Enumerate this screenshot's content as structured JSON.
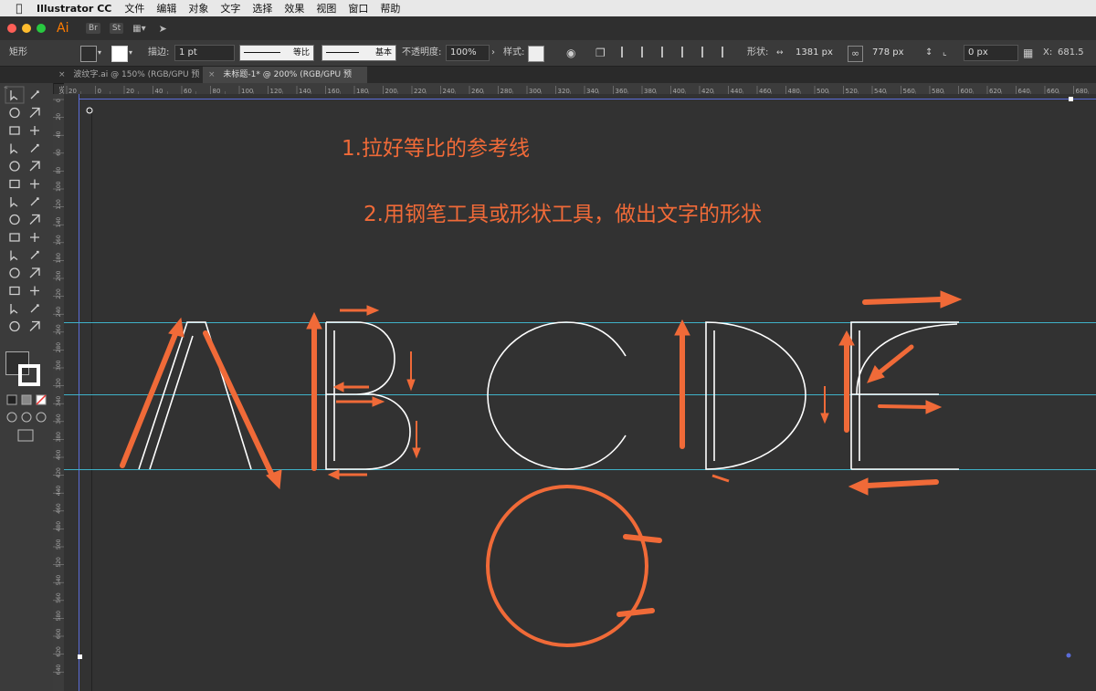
{
  "menubar": {
    "app_name": "Illustrator CC",
    "items": [
      "文件",
      "编辑",
      "对象",
      "文字",
      "选择",
      "效果",
      "视图",
      "窗口",
      "帮助"
    ]
  },
  "appbar": {
    "logo": "Ai",
    "buttons": [
      "Br",
      "St"
    ]
  },
  "control_bar": {
    "selection_type": "矩形",
    "stroke_label": "描边:",
    "stroke_weight": "1 pt",
    "profile_label": "等比",
    "brush_label": "基本",
    "opacity_label": "不透明度:",
    "opacity_value": "100%",
    "style_label": "样式:",
    "shape_label": "形状:",
    "width_value": "1381 px",
    "height_value": "778 px",
    "corner_value": "0 px",
    "x_label": "X:",
    "x_value": "681.5"
  },
  "tabs": [
    {
      "label": "波纹字.ai @ 150% (RGB/GPU 预览)",
      "active": false
    },
    {
      "label": "未标题-1* @ 200% (RGB/GPU 预览)",
      "active": true
    }
  ],
  "ruler_h_ticks": [
    "20",
    "0",
    "20",
    "40",
    "60",
    "80",
    "100",
    "120",
    "140",
    "160",
    "180",
    "200",
    "220",
    "240",
    "260",
    "280",
    "300",
    "320",
    "340",
    "360",
    "380",
    "400",
    "420",
    "440",
    "460",
    "480",
    "500",
    "520",
    "540",
    "560",
    "580",
    "600",
    "620",
    "640",
    "660",
    "680"
  ],
  "ruler_v_ticks": [
    "0",
    "20",
    "40",
    "60",
    "80",
    "100",
    "120",
    "140",
    "160",
    "180",
    "200",
    "220",
    "240",
    "260",
    "280",
    "300",
    "320",
    "340",
    "360",
    "380",
    "400",
    "420",
    "440",
    "460",
    "480",
    "500",
    "520",
    "540",
    "560",
    "580",
    "600",
    "620",
    "640"
  ],
  "annotations": {
    "step1": "1.拉好等比的参考线",
    "step2": "2.用钢笔工具或形状工具，做出文字的形状"
  },
  "colors": {
    "annotation": "#f06a38",
    "guide": "#3fb2c8",
    "artboard": "#5b6cd8",
    "glyph_stroke": "#ffffff",
    "canvas_bg": "#323232"
  },
  "icons": {
    "toolbar": [
      "selection-tool-icon",
      "direct-selection-tool-icon",
      "magic-wand-icon",
      "lasso-icon",
      "pen-tool-icon",
      "curvature-tool-icon",
      "type-tool-icon",
      "line-tool-icon",
      "ellipse-tool-icon",
      "paintbrush-icon",
      "shaper-tool-icon",
      "eraser-icon",
      "rotate-tool-icon",
      "scale-tool-icon",
      "width-tool-icon",
      "free-transform-icon",
      "shape-builder-icon",
      "perspective-grid-icon",
      "mesh-tool-icon",
      "gradient-tool-icon",
      "eyedropper-icon",
      "blend-tool-icon",
      "symbol-sprayer-icon",
      "column-graph-icon",
      "artboard-tool-icon",
      "slice-tool-icon",
      "hand-tool-icon",
      "zoom-tool-icon"
    ]
  }
}
